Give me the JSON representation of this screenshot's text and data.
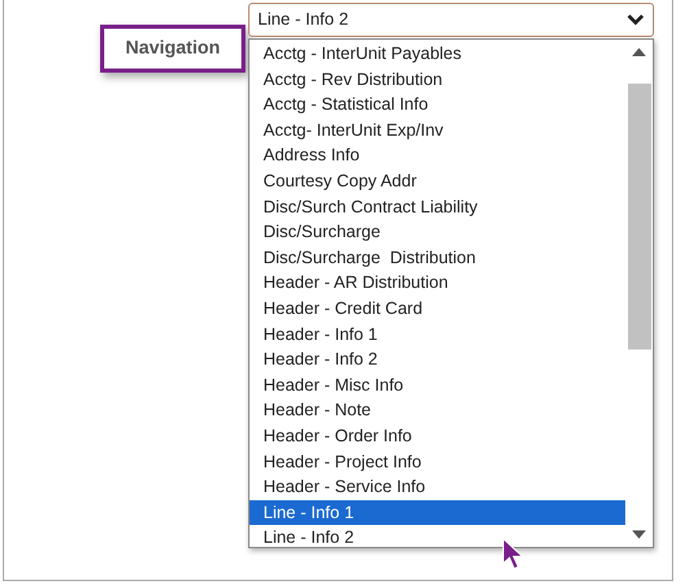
{
  "label": "Navigation",
  "select": {
    "value": "Line - Info 2"
  },
  "options": [
    {
      "text": "Acctg - InterUnit Payables",
      "selected": false
    },
    {
      "text": "Acctg - Rev Distribution",
      "selected": false
    },
    {
      "text": "Acctg - Statistical Info",
      "selected": false
    },
    {
      "text": "Acctg- InterUnit Exp/Inv",
      "selected": false
    },
    {
      "text": "Address Info",
      "selected": false
    },
    {
      "text": "Courtesy Copy Addr",
      "selected": false
    },
    {
      "text": "Disc/Surch Contract Liability",
      "selected": false
    },
    {
      "text": "Disc/Surcharge",
      "selected": false
    },
    {
      "text": "Disc/Surcharge  Distribution",
      "selected": false
    },
    {
      "text": "Header - AR Distribution",
      "selected": false
    },
    {
      "text": "Header - Credit Card",
      "selected": false
    },
    {
      "text": "Header - Info 1",
      "selected": false
    },
    {
      "text": "Header - Info 2",
      "selected": false
    },
    {
      "text": "Header - Misc Info",
      "selected": false
    },
    {
      "text": "Header - Note",
      "selected": false
    },
    {
      "text": "Header - Order Info",
      "selected": false
    },
    {
      "text": "Header - Project Info",
      "selected": false
    },
    {
      "text": "Header - Service Info",
      "selected": false
    },
    {
      "text": "Line - Info 1",
      "selected": true
    },
    {
      "text": "Line - Info 2",
      "selected": false
    }
  ]
}
